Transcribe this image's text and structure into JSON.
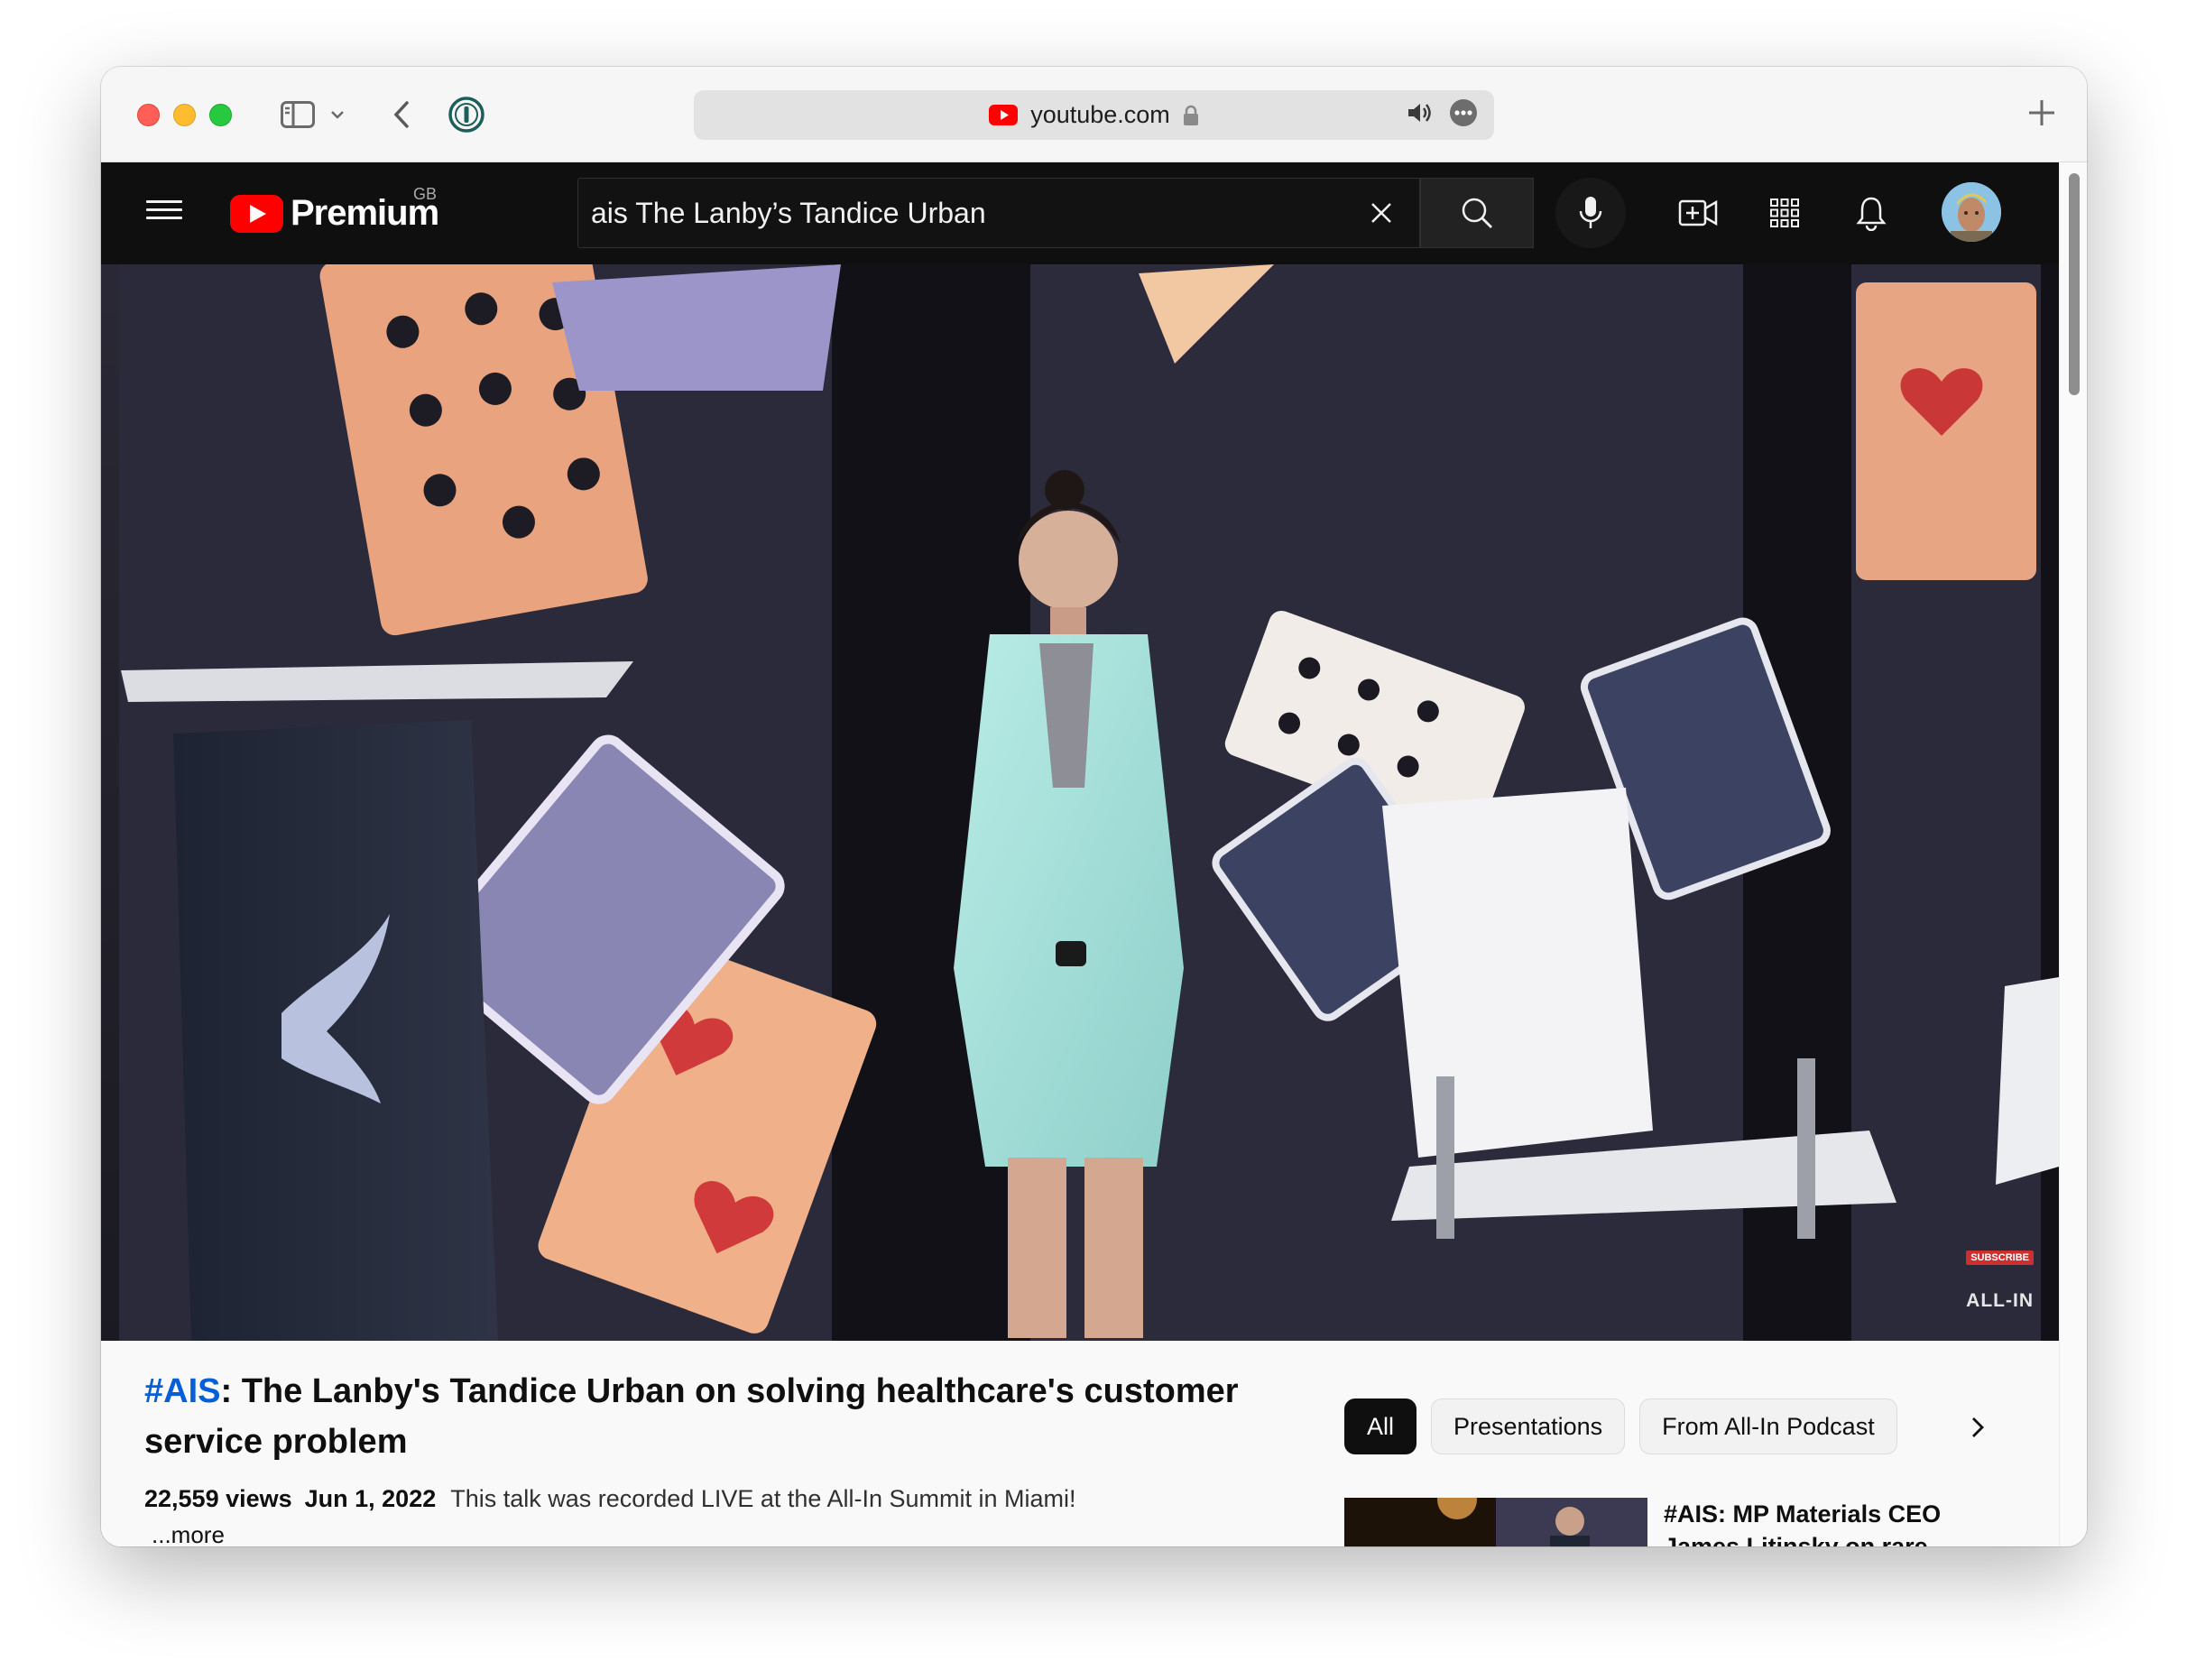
{
  "browser": {
    "address": "youtube.com",
    "icons": [
      "sidebar-icon",
      "chevron-down-icon",
      "back-icon",
      "password-manager-icon",
      "youtube-favicon-icon",
      "lock-icon",
      "speaker-icon",
      "more-icon",
      "plus-icon"
    ]
  },
  "youtube": {
    "logo_text": "Premium",
    "country": "GB",
    "search": {
      "value": "ais The Lanby’s Tandice Urban"
    },
    "header_icons": [
      "menu-icon",
      "clear-icon",
      "search-icon",
      "microphone-icon",
      "create-video-icon",
      "apps-grid-icon",
      "notifications-bell-icon",
      "avatar"
    ]
  },
  "video": {
    "channel_watermark": {
      "subscribe_label": "SUBSCRIBE",
      "brand": "ALL-IN"
    },
    "title_hashtag": "#AIS",
    "title_rest": ": The Lanby's Tandice Urban on solving healthcare's customer service problem",
    "views": "22,559 views",
    "date": "Jun 1, 2022",
    "description": "This talk was recorded LIVE at the All-In Summit in Miami!",
    "more_label": "...more"
  },
  "sidebar": {
    "chips": [
      {
        "label": "All",
        "active": true
      },
      {
        "label": "Presentations",
        "active": false
      },
      {
        "label": "From All-In Podcast",
        "active": false
      }
    ],
    "recommendation": {
      "title": "#AIS: MP Materials CEO James Litinsky on rare"
    }
  },
  "colors": {
    "youtube_red": "#ff0000",
    "header_bg": "#0f0f0f",
    "hashtag_blue": "#065fd4",
    "jacket_mint": "#a8e0dc"
  }
}
